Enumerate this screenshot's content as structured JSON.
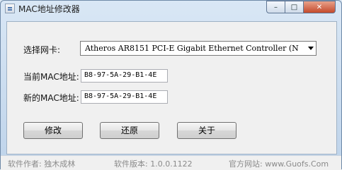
{
  "window": {
    "title": "MAC地址修改器"
  },
  "form": {
    "adapter_label": "选择网卡:",
    "adapter_value": "Atheros AR8151 PCI-E Gigabit Ethernet Controller (N",
    "current_mac_label": "当前MAC地址:",
    "current_mac_value": "B8-97-5A-29-B1-4E",
    "new_mac_label": "新的MAC地址:",
    "new_mac_value": "B8-97-5A-29-B1-4E"
  },
  "buttons": {
    "modify": "修改",
    "restore": "还原",
    "about": "关于"
  },
  "status": {
    "author": "软件作者: 独木成林",
    "version": "软件版本: 1.0.0.1122",
    "website": "官方网站: www.Guofs.Com"
  },
  "icons": [
    "app-icon",
    "minimize-icon",
    "maximize-icon",
    "close-icon",
    "dropdown-arrow-icon"
  ]
}
